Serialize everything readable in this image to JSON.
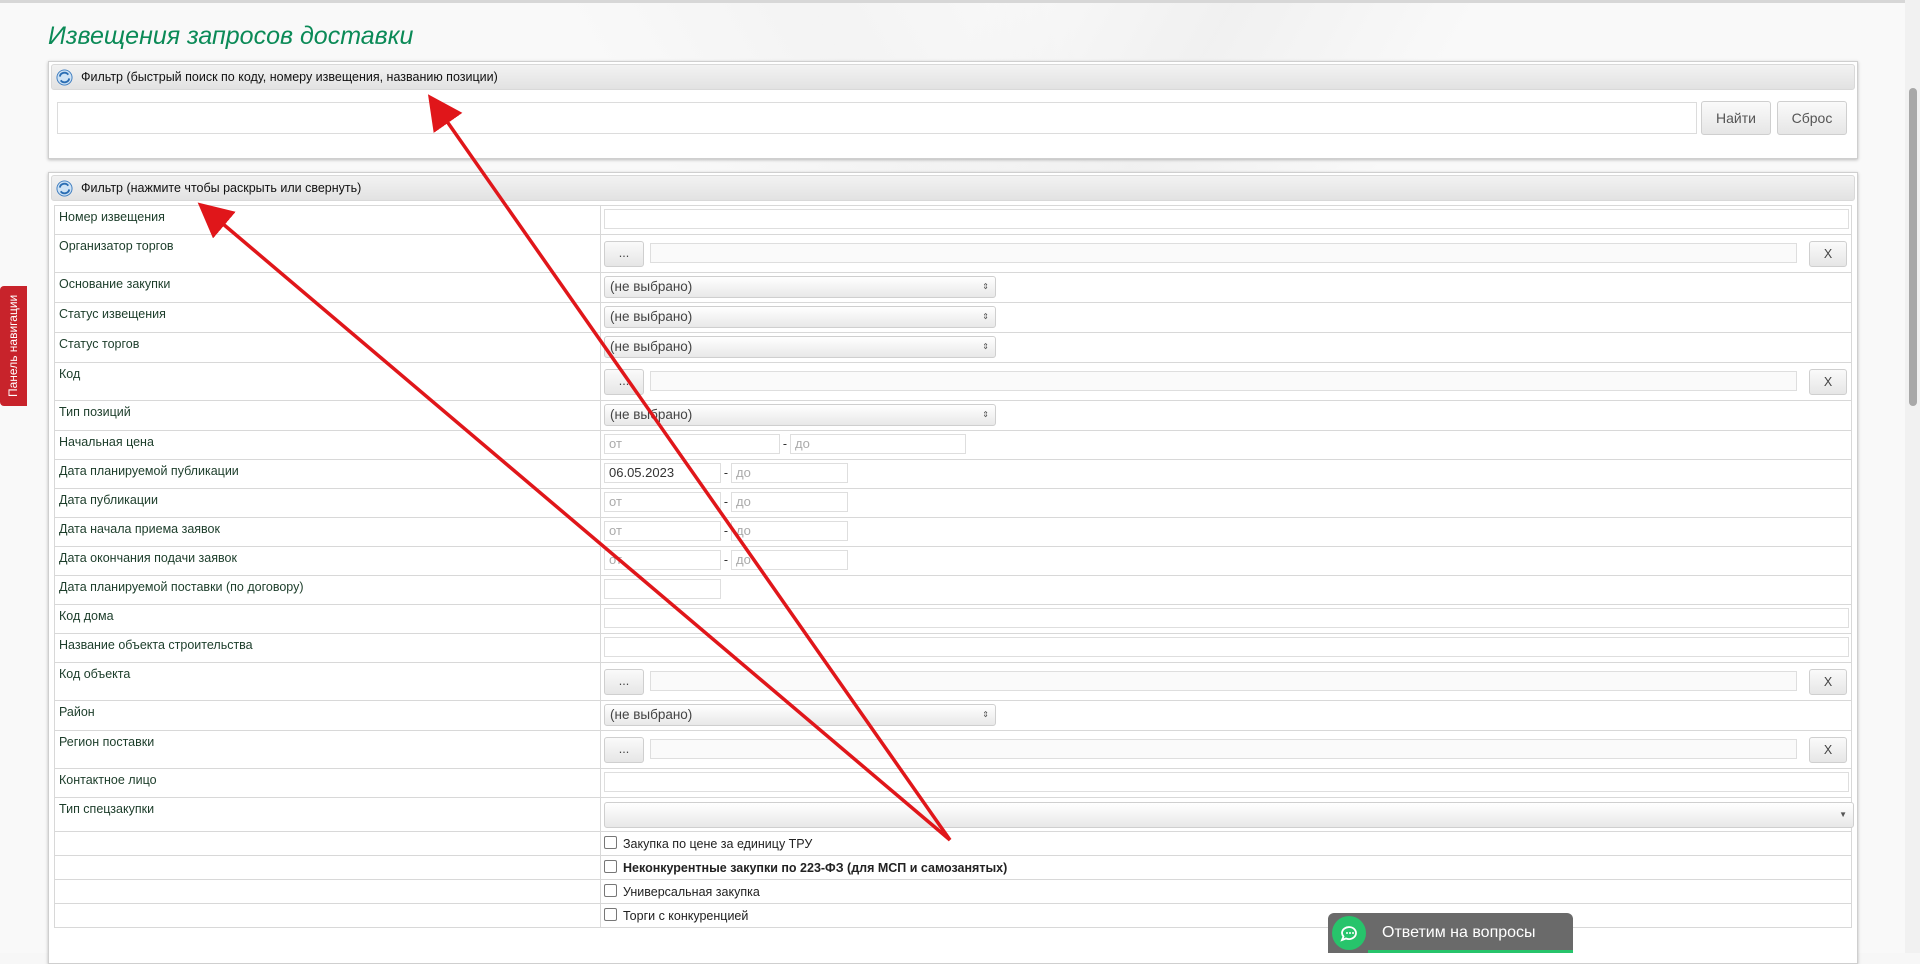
{
  "page": {
    "title": "Извещения запросов доставки"
  },
  "quick_filter": {
    "header": "Фильтр (быстрый поиск по коду, номеру извещения, названию позиции)",
    "input_value": "",
    "find_button": "Найти",
    "reset_button": "Сброс"
  },
  "filter": {
    "header": "Фильтр (нажмите чтобы раскрыть или свернуть)",
    "rows": {
      "notice_number": "Номер извещения",
      "organizer": "Организатор торгов",
      "purchase_basis": "Основание закупки",
      "notice_status": "Статус извещения",
      "tender_status": "Статус торгов",
      "code": "Код",
      "position_type": "Тип позиций",
      "initial_price": "Начальная цена",
      "planned_pub_date": "Дата планируемой публикации",
      "pub_date": "Дата публикации",
      "app_start_date": "Дата начала приема заявок",
      "app_end_date": "Дата окончания подачи заявок",
      "planned_delivery_date": "Дата планируемой поставки (по договору)",
      "house_code": "Код дома",
      "construction_name": "Название объекта строительства",
      "object_code": "Код объекта",
      "district": "Район",
      "delivery_region": "Регион поставки",
      "contact_person": "Контактное лицо",
      "special_purchase_type": "Тип спецзакупки"
    },
    "select_placeholder": "(не выбрано)",
    "from_placeholder": "от",
    "to_placeholder": "до",
    "dash": "-",
    "dots_label": "...",
    "clear_label": "X",
    "planned_pub_from_value": "06.05.2023",
    "checkboxes": {
      "unit_price": "Закупка по цене за единицу ТРУ",
      "noncompetitive": "Неконкурентные закупки по 223-ФЗ (для МСП и самозанятых)",
      "universal": "Универсальная закупка",
      "competition": "Торги с конкуренцией"
    }
  },
  "side_tab": {
    "label": "Панель навигации"
  },
  "chat": {
    "label": "Ответим на вопросы"
  },
  "colors": {
    "title": "#0b8a57",
    "arrow": "#e0161a",
    "side_tab": "#c8232b",
    "chat_bubble": "#27c46b"
  },
  "icons": [
    "refresh-icon",
    "chevron-down-icon",
    "chat-icon"
  ]
}
